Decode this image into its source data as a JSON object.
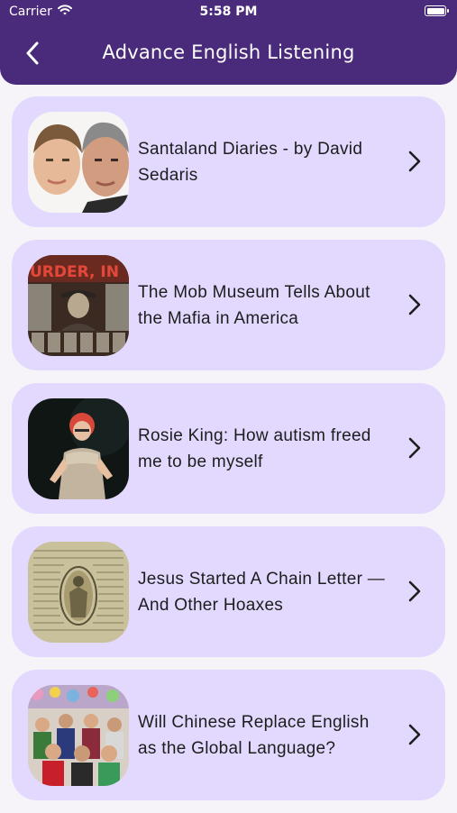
{
  "status_bar": {
    "carrier": "Carrier",
    "time": "5:58 PM"
  },
  "header": {
    "title": "Advance English Listening",
    "background": "#4a2a7a"
  },
  "colors": {
    "card_background": "#e3d9ff",
    "page_background": "#f6f4f8",
    "text": "#1d1d1d"
  },
  "lessons": [
    {
      "title": "Santaland Diaries - by David Sedaris",
      "thumbnail": "two-faces-photo"
    },
    {
      "title": "The Mob Museum Tells About the Mafia in America",
      "thumbnail": "mob-poster-photo",
      "thumbnail_text": "URDER, IN"
    },
    {
      "title": "Rosie King:  How autism freed me to be myself",
      "thumbnail": "speaker-on-stage-photo"
    },
    {
      "title": "Jesus Started A Chain Letter — And Other Hoaxes",
      "thumbnail": "old-letter-photo"
    },
    {
      "title": "Will Chinese Replace English as the Global Language?",
      "thumbnail": "classroom-photo"
    }
  ]
}
